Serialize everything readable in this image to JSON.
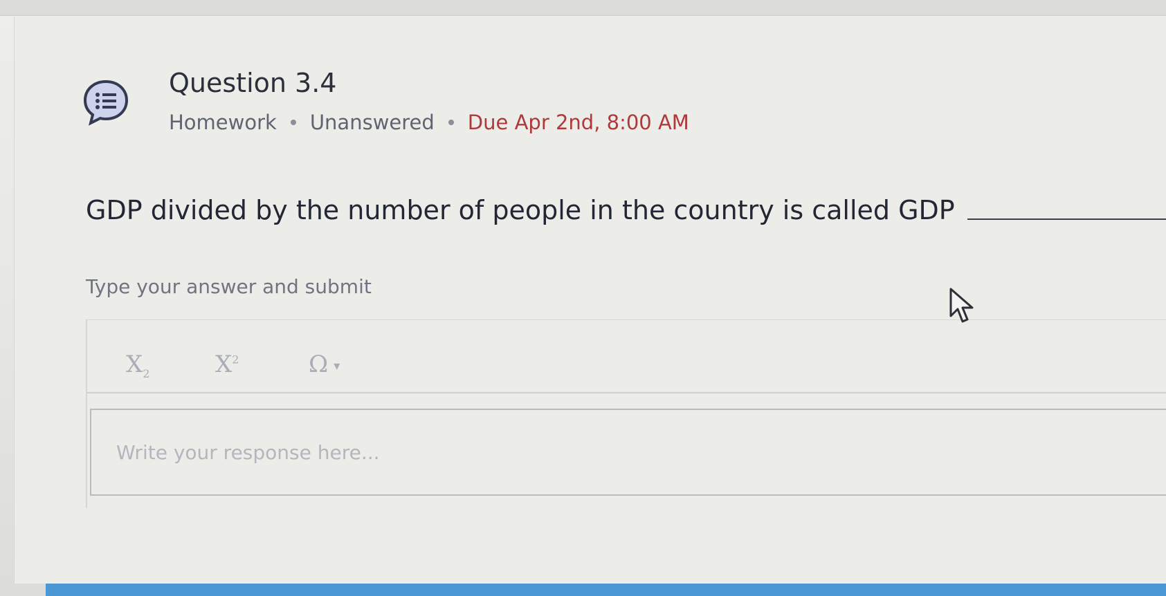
{
  "question": {
    "title": "Question 3.4",
    "meta": {
      "type": "Homework",
      "status": "Unanswered",
      "due": "Due Apr 2nd, 8:00 AM"
    },
    "prompt": "GDP divided by the number of people in the country is called GDP",
    "prompt_end": "."
  },
  "answer": {
    "instruction": "Type your answer and submit",
    "toolbar": {
      "subscript_label": "X",
      "subscript_mark": "2",
      "superscript_label": "X",
      "superscript_mark": "2",
      "symbol_label": "Ω",
      "symbol_caret": "▾"
    },
    "response_placeholder": "Write your response here...",
    "response_value": ""
  },
  "colors": {
    "due": "#b0383a",
    "icon": "#5a6aa8",
    "accent_bar": "#4a97d4"
  },
  "icons": {
    "question_icon": "chat-list-icon",
    "cursor": "mouse-pointer-icon"
  }
}
